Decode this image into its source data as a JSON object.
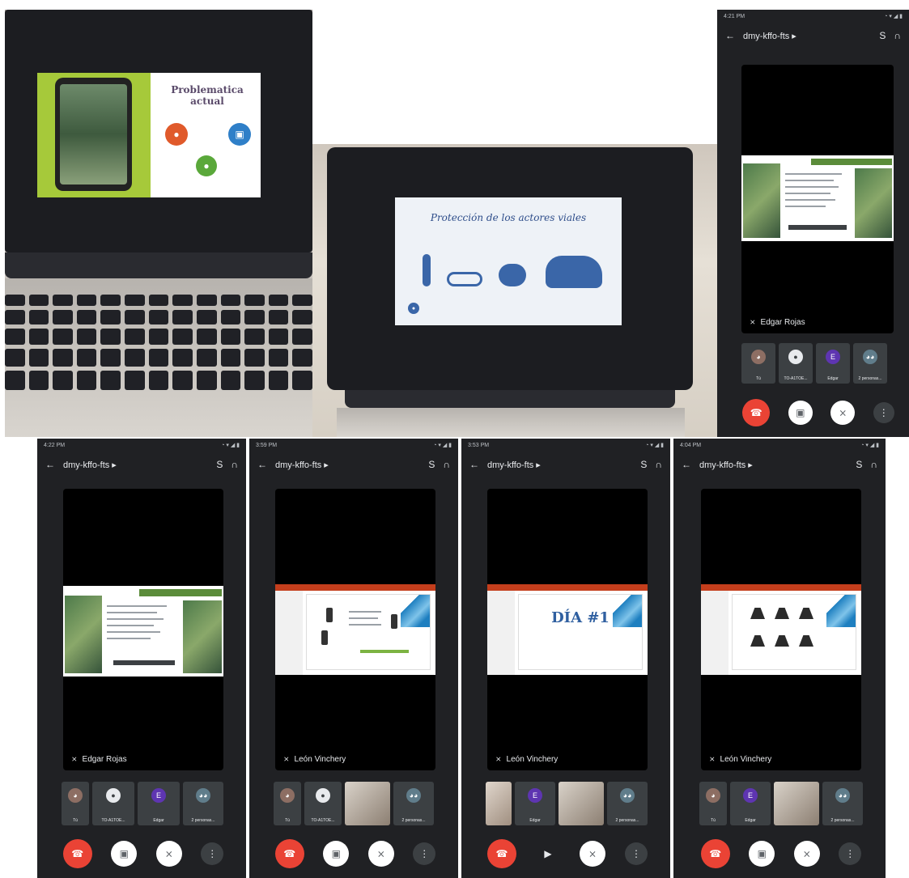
{
  "photo1": {
    "slide_title": "Problematica\nactual"
  },
  "photo2": {
    "slide_title": "Protección de los actores viales"
  },
  "meeting": {
    "code": "dmy-kffo-fts ▸",
    "buttons": {
      "back": "←",
      "switch_cam": "S",
      "audio": "∩",
      "more": "⋮"
    }
  },
  "phones": [
    {
      "status_time": "4:21 PM",
      "speaker": "Edgar Rojas",
      "share_type": "doc",
      "tiles": [
        {
          "label": "Tú",
          "avatar": "photo"
        },
        {
          "label": "TO-A1TOE...",
          "avatar": "person"
        },
        {
          "label": "Edgar",
          "avatar": "E"
        },
        {
          "label": "2 personas...",
          "avatar": "group"
        }
      ],
      "camera_icon": "camera-off"
    },
    {
      "status_time": "4:22 PM",
      "speaker": "Edgar Rojas",
      "share_type": "doc",
      "tiles": [
        {
          "label": "Tú",
          "avatar": "photo"
        },
        {
          "label": "TO-A1TOE...",
          "avatar": "person"
        },
        {
          "label": "Edgar",
          "avatar": "E"
        },
        {
          "label": "2 personas...",
          "avatar": "group"
        }
      ],
      "camera_icon": "camera-off"
    },
    {
      "status_time": "3:59 PM",
      "speaker": "León Vinchery",
      "share_type": "lights",
      "tiles": [
        {
          "label": "Tú",
          "avatar": "photo"
        },
        {
          "label": "TO-A1TOE...",
          "avatar": "person"
        },
        {
          "label": "",
          "avatar": "video"
        },
        {
          "label": "2 personas...",
          "avatar": "group"
        }
      ],
      "camera_icon": "camera-off"
    },
    {
      "status_time": "3:53 PM",
      "speaker": "León Vinchery",
      "share_type": "dia",
      "share_text": "DÍA #1",
      "tiles": [
        {
          "label": "",
          "avatar": "video"
        },
        {
          "label": "Edgar",
          "avatar": "E"
        },
        {
          "label": "",
          "avatar": "video"
        },
        {
          "label": "2 personas...",
          "avatar": "group"
        }
      ],
      "camera_icon": "camera-on"
    },
    {
      "status_time": "4:04 PM",
      "speaker": "León Vinchery",
      "share_type": "roads",
      "tiles": [
        {
          "label": "Tú",
          "avatar": "photo"
        },
        {
          "label": "Edgar",
          "avatar": "E"
        },
        {
          "label": "",
          "avatar": "video"
        },
        {
          "label": "2 personas...",
          "avatar": "group"
        }
      ],
      "camera_icon": "camera-off"
    }
  ],
  "colors": {
    "meet_bg": "#202124",
    "end_call": "#ea4335",
    "avatar_e": "#5e35b1"
  }
}
